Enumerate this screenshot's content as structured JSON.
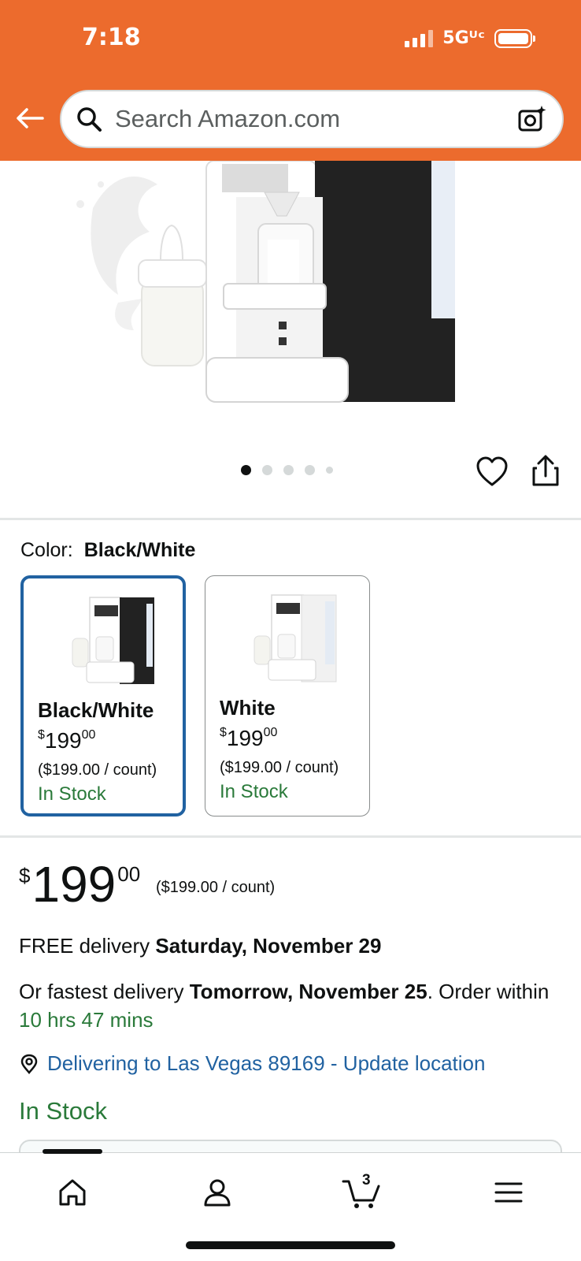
{
  "status_bar": {
    "time": "7:18",
    "network": "5Gᵁᶜ"
  },
  "header": {
    "search_placeholder": "Search Amazon.com"
  },
  "gallery": {
    "image_count": 5,
    "active_index": 0
  },
  "color": {
    "label": "Color:",
    "selected": "Black/White",
    "options": [
      {
        "name": "Black/White",
        "currency": "$",
        "whole": "199",
        "fraction": "00",
        "unit_price": "($199.00 / count)",
        "stock": "In Stock"
      },
      {
        "name": "White",
        "currency": "$",
        "whole": "199",
        "fraction": "00",
        "unit_price": "($199.00 / count)",
        "stock": "In Stock"
      }
    ]
  },
  "price": {
    "currency": "$",
    "whole": "199",
    "fraction": "00",
    "unit_price": "($199.00 / count)"
  },
  "delivery": {
    "free_prefix": "FREE delivery ",
    "free_date": "Saturday, November 29",
    "fast_prefix": "Or fastest delivery ",
    "fast_date": "Tomorrow, November 25",
    "fast_suffix": ". Order within ",
    "countdown": "10 hrs 47 mins",
    "location": "Delivering to Las Vegas 89169 - Update location"
  },
  "availability": "In Stock",
  "bottom_nav": {
    "cart_count": "3"
  },
  "colors": {
    "brand_orange": "#ec6b2d",
    "link_blue": "#2162a1",
    "stock_green": "#2a7a3a"
  }
}
